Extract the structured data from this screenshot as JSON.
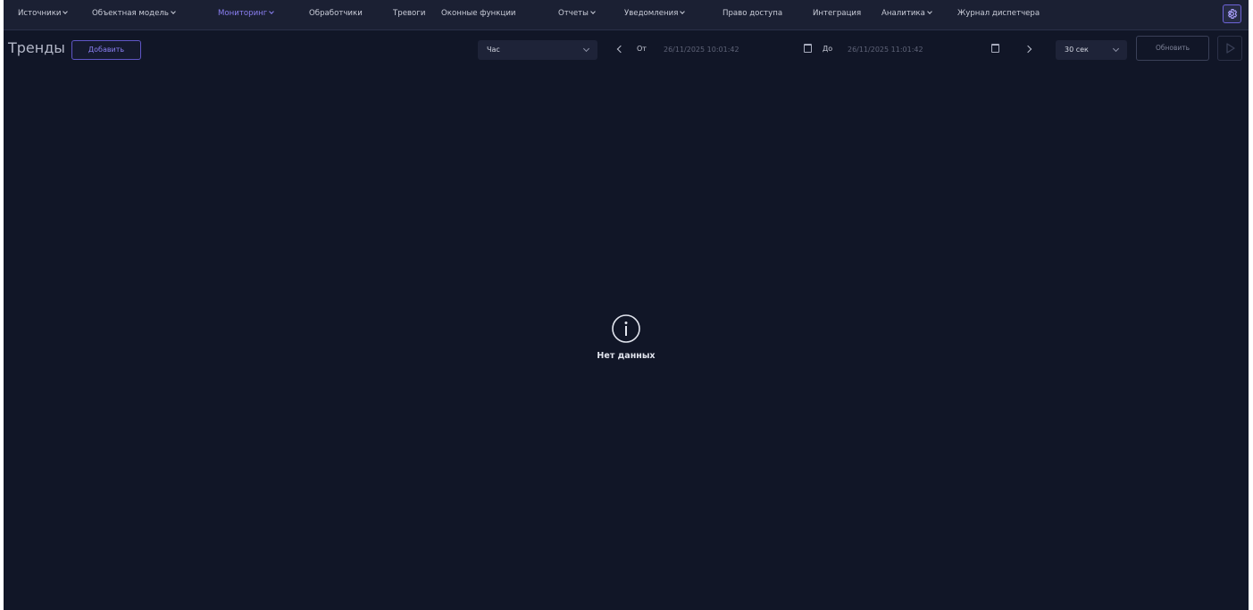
{
  "nav": {
    "items": [
      {
        "label": "Источники",
        "has_dropdown": true,
        "active": false
      },
      {
        "label": "Объектная модель",
        "has_dropdown": true,
        "active": false
      },
      {
        "label": "Мониторинг",
        "has_dropdown": true,
        "active": true
      },
      {
        "label": "Обработчики",
        "has_dropdown": false,
        "active": false
      },
      {
        "label": "Тревоги",
        "has_dropdown": false,
        "active": false
      },
      {
        "label": "Оконные функции",
        "has_dropdown": false,
        "active": false
      },
      {
        "label": "Отчеты",
        "has_dropdown": true,
        "active": false
      },
      {
        "label": "Уведомления",
        "has_dropdown": true,
        "active": false
      },
      {
        "label": "Право доступа",
        "has_dropdown": false,
        "active": false
      },
      {
        "label": "Интеграция",
        "has_dropdown": false,
        "active": false
      },
      {
        "label": "Аналитика",
        "has_dropdown": true,
        "active": false
      },
      {
        "label": "Журнал диспетчера",
        "has_dropdown": false,
        "active": false
      }
    ],
    "settings_icon": "gear-icon"
  },
  "toolbar": {
    "title": "Тренды",
    "add_label": "Добавить",
    "period_value": "Час",
    "from_label": "От",
    "from_value": "26/11/2025 10:01:42",
    "to_label": "До",
    "to_value": "26/11/2025 11:01:42",
    "interval_value": "30 сек",
    "refresh_label": "Обновить"
  },
  "empty_state": {
    "icon": "info-circle-icon",
    "message": "Нет данных"
  },
  "colors": {
    "background": "#111627",
    "nav_background": "#1b2033",
    "accent": "#8a7ff2"
  }
}
